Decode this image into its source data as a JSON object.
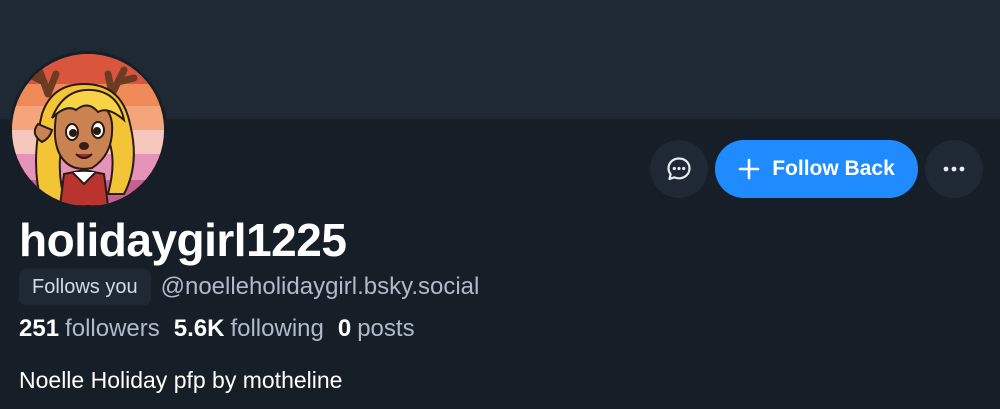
{
  "profile": {
    "display_name": "holidaygirl1225",
    "follows_you_badge": "Follows you",
    "handle": "@noelleholidaygirl.bsky.social",
    "bio": "Noelle Holiday pfp by motheline"
  },
  "stats": {
    "followers_count": "251",
    "followers_label": "followers",
    "following_count": "5.6K",
    "following_label": "following",
    "posts_count": "0",
    "posts_label": "posts"
  },
  "actions": {
    "follow_back_label": "Follow Back",
    "message_icon": "message-icon",
    "more_icon": "ellipsis-icon",
    "plus_icon": "plus-icon"
  },
  "colors": {
    "background": "#161e27",
    "banner": "#1e2934",
    "accent": "#208bfe",
    "text_primary": "#ffffff",
    "text_secondary": "#aebbc9"
  }
}
